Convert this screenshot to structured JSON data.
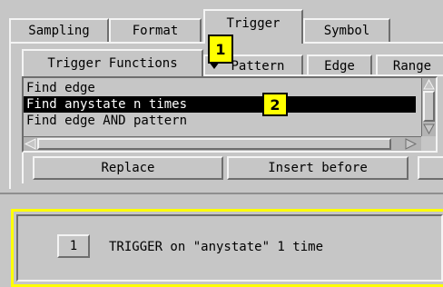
{
  "top_tabs": [
    {
      "label": "Sampling"
    },
    {
      "label": "Format"
    },
    {
      "label": "Trigger",
      "active": true
    },
    {
      "label": "Symbol"
    }
  ],
  "sub_tabs": [
    {
      "label": "Trigger Functions",
      "active": true
    },
    {
      "label": "Pattern"
    },
    {
      "label": "Edge"
    },
    {
      "label": "Range"
    }
  ],
  "functions_list": {
    "items": [
      "Find edge",
      "Find anystate n times",
      "Find edge AND pattern"
    ],
    "selected_index": 1
  },
  "buttons": {
    "replace": "Replace",
    "insert_before": "Insert before"
  },
  "sequence": {
    "step_number": "1",
    "step_text": "TRIGGER on \"anystate\" 1 time"
  },
  "callouts": [
    "1",
    "2"
  ],
  "colors": {
    "panel": "#c6c6c6",
    "highlight_border": "#ffff00",
    "callout_fill": "#ffff00",
    "selection": "#000000"
  }
}
